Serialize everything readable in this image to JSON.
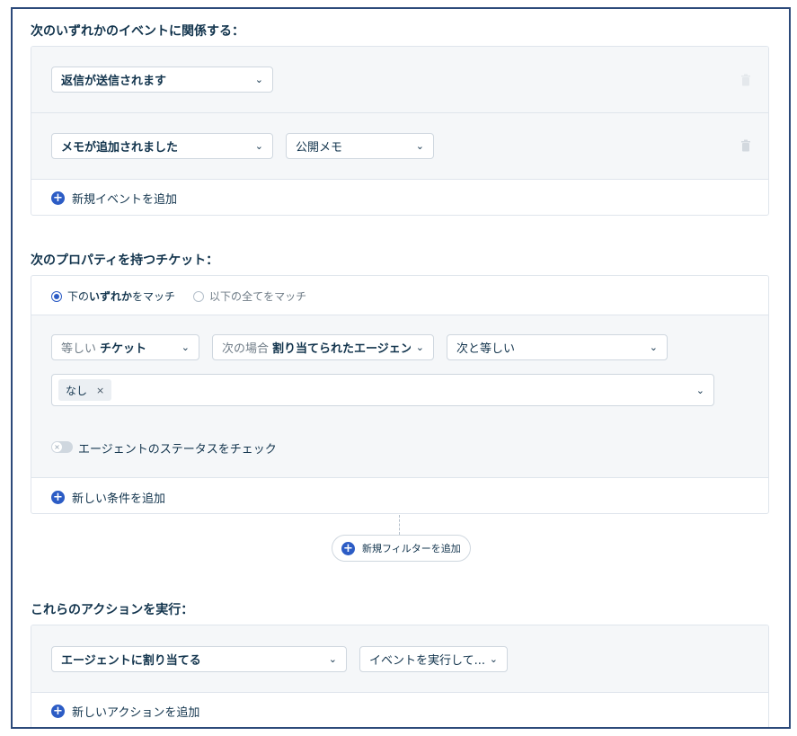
{
  "events": {
    "heading": "次のいずれかのイベントに関係する：",
    "rows": [
      {
        "event": "返信が送信されます"
      },
      {
        "event": "メモが追加されました",
        "secondary": "公開メモ"
      }
    ],
    "add_label": "新規イベントを追加"
  },
  "properties": {
    "heading": "次のプロパティを持つチケット：",
    "match_any": {
      "prefix": "下の",
      "bold": "いずれか",
      "suffix": "をマッチ"
    },
    "match_all": {
      "prefix": "以下の",
      "bold": "全て",
      "suffix": "をマッチ"
    },
    "condition": {
      "field_prefix": "等しい",
      "field": "チケット",
      "when_prefix": "次の場合",
      "when": "割り当てられたエージェン",
      "operator": "次と等しい",
      "tag": "なし",
      "tag_remove": "×"
    },
    "toggle_label": "エージェントのステータスをチェック",
    "add_condition_label": "新しい条件を追加"
  },
  "filter": {
    "add_label": "新規フィルターを追加"
  },
  "actions": {
    "heading": "これらのアクションを実行：",
    "action": "エージェントに割り当てる",
    "secondary": "イベントを実行して...",
    "add_label": "新しいアクションを追加"
  },
  "colors": {
    "accent": "#2c5cc5",
    "text": "#12344d",
    "border": "#2c4a7a"
  },
  "icons": {
    "chevron": "chevron-down-icon",
    "trash": "trash-icon",
    "plus": "plus-circle-icon"
  }
}
